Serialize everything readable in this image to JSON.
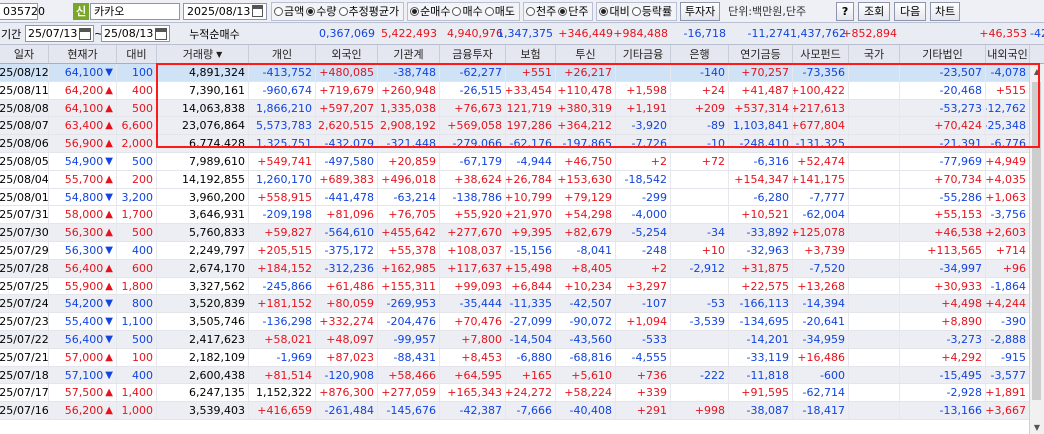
{
  "toolbar": {
    "code": "035720",
    "badge": "신",
    "stock_name": "카카오",
    "date": "2025/08/13",
    "radio_group1": [
      {
        "label": "금액",
        "on": false
      },
      {
        "label": "수량",
        "on": true
      },
      {
        "label": "추정평균가",
        "on": false
      }
    ],
    "radio_group2": [
      {
        "label": "순매수",
        "on": true
      },
      {
        "label": "매수",
        "on": false
      },
      {
        "label": "매도",
        "on": false
      }
    ],
    "radio_group3": [
      {
        "label": "천주",
        "on": false
      },
      {
        "label": "단주",
        "on": true
      }
    ],
    "radio_group4": [
      {
        "label": "대비",
        "on": true
      },
      {
        "label": "등락률",
        "on": false
      }
    ],
    "investor_button": "투자자",
    "unit_label": "단위:백만원,단주",
    "help_button": "?",
    "search_button": "조회",
    "next_button": "다음",
    "chart_button": "차트"
  },
  "period": {
    "label": "기간",
    "from": "25/07/13",
    "to": "25/08/13",
    "sum_label": "누적순매수",
    "sums": [
      "0,367,069",
      "5,422,493",
      "4,940,976",
      "1,347,375",
      "+346,449",
      "+984,488",
      "-16,718",
      "-11,274",
      "1,437,762",
      "+852,894",
      "",
      "+46,353",
      "-42,753"
    ],
    "sum_colors": [
      "blue",
      "red",
      "red",
      "blue",
      "red",
      "red",
      "blue",
      "blue",
      "blue",
      "red",
      "",
      "red",
      "blue"
    ]
  },
  "columns": [
    "일자",
    "현재가",
    "대비",
    "거래량",
    "개인",
    "외국인",
    "기관계",
    "금융투자",
    "보험",
    "투신",
    "기타금융",
    "은행",
    "연기금등",
    "사모펀드",
    "국가",
    "기타법인",
    "내외국인"
  ],
  "rows": [
    [
      "25/08/12",
      "64,100",
      "down",
      "100",
      "4,891,324",
      "-413,752",
      "+480,085",
      "-38,748",
      "-62,277",
      "+551",
      "+26,217",
      "",
      "-140",
      "+70,257",
      "-73,356",
      "",
      "-23,507",
      "-4,078"
    ],
    [
      "25/08/11",
      "64,200",
      "up",
      "400",
      "7,390,161",
      "-960,674",
      "+719,679",
      "+260,948",
      "-26,515",
      "+33,454",
      "+110,478",
      "+1,598",
      "+24",
      "+41,487",
      "+100,422",
      "",
      "-20,468",
      "+515"
    ],
    [
      "25/08/08",
      "64,100",
      "up",
      "500",
      "14,063,838",
      "1,866,210",
      "+597,207",
      "1,335,038",
      "+76,673",
      "+121,719",
      "+380,319",
      "+1,191",
      "+209",
      "+537,314",
      "+217,613",
      "",
      "-53,273",
      "-12,762"
    ],
    [
      "25/08/07",
      "63,400",
      "up",
      "6,600",
      "23,076,864",
      "5,573,783",
      "2,620,515",
      "2,908,192",
      "+569,058",
      "+197,286",
      "+364,212",
      "-3,920",
      "-89",
      "1,103,841",
      "+677,804",
      "",
      "+70,424",
      "-25,348"
    ],
    [
      "25/08/06",
      "56,900",
      "up",
      "2,000",
      "6,774,428",
      "1,325,751",
      "-432,079",
      "-321,448",
      "-279,066",
      "-62,176",
      "-197,865",
      "-7,726",
      "-10",
      "-248,410",
      "-131,325",
      "",
      "-21,391",
      "-6,776"
    ],
    [
      "25/08/05",
      "54,900",
      "down",
      "500",
      "7,989,610",
      "+549,741",
      "-497,580",
      "+20,859",
      "-67,179",
      "-4,944",
      "+46,750",
      "+2",
      "+72",
      "-6,316",
      "+52,474",
      "",
      "-77,969",
      "+4,949"
    ],
    [
      "25/08/04",
      "55,700",
      "up",
      "200",
      "14,192,855",
      "1,260,170",
      "+689,383",
      "+496,018",
      "+38,624",
      "+26,784",
      "+153,630",
      "-18,542",
      "",
      "+154,347",
      "+141,175",
      "",
      "+70,734",
      "+4,035"
    ],
    [
      "25/08/01",
      "54,800",
      "down",
      "3,200",
      "3,960,200",
      "+558,915",
      "-441,478",
      "-63,214",
      "-138,786",
      "+10,799",
      "+79,129",
      "-299",
      "",
      "-6,280",
      "-7,777",
      "",
      "-55,286",
      "+1,063"
    ],
    [
      "25/07/31",
      "58,000",
      "up",
      "1,700",
      "3,646,931",
      "-209,198",
      "+81,096",
      "+76,705",
      "+55,920",
      "+21,970",
      "+54,298",
      "-4,000",
      "",
      "+10,521",
      "-62,004",
      "",
      "+55,153",
      "-3,756"
    ],
    [
      "25/07/30",
      "56,300",
      "up",
      "500",
      "5,760,833",
      "+59,827",
      "-564,610",
      "+455,642",
      "+277,670",
      "+9,395",
      "+82,679",
      "-5,254",
      "-34",
      "-33,892",
      "+125,078",
      "",
      "+46,538",
      "+2,603"
    ],
    [
      "25/07/29",
      "56,300",
      "down",
      "400",
      "2,249,797",
      "+205,515",
      "-375,172",
      "+55,378",
      "+108,037",
      "-15,156",
      "-8,041",
      "-248",
      "+10",
      "-32,963",
      "+3,739",
      "",
      "+113,565",
      "+714"
    ],
    [
      "25/07/28",
      "56,400",
      "up",
      "600",
      "2,674,170",
      "+184,152",
      "-312,236",
      "+162,985",
      "+117,637",
      "+15,498",
      "+8,405",
      "+2",
      "-2,912",
      "+31,875",
      "-7,520",
      "",
      "-34,997",
      "+96"
    ],
    [
      "25/07/25",
      "55,900",
      "up",
      "1,800",
      "3,327,562",
      "-245,866",
      "+61,486",
      "+155,311",
      "+99,093",
      "+6,844",
      "+10,234",
      "+3,297",
      "",
      "+22,575",
      "+13,268",
      "",
      "+30,933",
      "-1,864"
    ],
    [
      "25/07/24",
      "54,200",
      "down",
      "800",
      "3,520,839",
      "+181,152",
      "+80,059",
      "-269,953",
      "-35,444",
      "-11,335",
      "-42,507",
      "-107",
      "-53",
      "-166,113",
      "-14,394",
      "",
      "+4,498",
      "+4,244"
    ],
    [
      "25/07/23",
      "55,400",
      "down",
      "1,100",
      "3,505,746",
      "-136,298",
      "+332,274",
      "-204,476",
      "+70,476",
      "-27,099",
      "-90,072",
      "+1,094",
      "-3,539",
      "-134,695",
      "-20,641",
      "",
      "+8,890",
      "-390"
    ],
    [
      "25/07/22",
      "56,400",
      "down",
      "500",
      "2,417,623",
      "+58,021",
      "+48,097",
      "-99,957",
      "+7,800",
      "-14,504",
      "-43,560",
      "-533",
      "",
      "-14,201",
      "-34,959",
      "",
      "-3,273",
      "-2,888"
    ],
    [
      "25/07/21",
      "57,000",
      "up",
      "100",
      "2,182,109",
      "-1,969",
      "+87,023",
      "-88,431",
      "+8,453",
      "-6,880",
      "-68,816",
      "-4,555",
      "",
      "-33,119",
      "+16,486",
      "",
      "+4,292",
      "-915"
    ],
    [
      "25/07/18",
      "57,100",
      "down",
      "400",
      "2,600,438",
      "+81,514",
      "-120,908",
      "+58,466",
      "+64,595",
      "+165",
      "+5,610",
      "+736",
      "-222",
      "-11,818",
      "-600",
      "",
      "-15,495",
      "-3,577"
    ],
    [
      "25/07/17",
      "57,500",
      "up",
      "1,400",
      "6,247,135",
      "1,152,322",
      "+876,300",
      "+277,059",
      "+165,343",
      "+24,272",
      "+58,224",
      "+339",
      "",
      "+91,595",
      "-62,714",
      "",
      "-2,928",
      "+1,891"
    ],
    [
      "25/07/16",
      "56,200",
      "up",
      "1,000",
      "3,539,403",
      "+416,659",
      "-261,484",
      "-145,676",
      "-42,387",
      "-7,666",
      "-40,408",
      "+291",
      "+998",
      "-38,087",
      "-18,417",
      "",
      "-13,166",
      "+3,667"
    ]
  ],
  "colors": {
    "up": "#e8121c",
    "down": "#1144e0",
    "highlight": "#ff1a1a",
    "selected_row": "#cfe2f6"
  }
}
